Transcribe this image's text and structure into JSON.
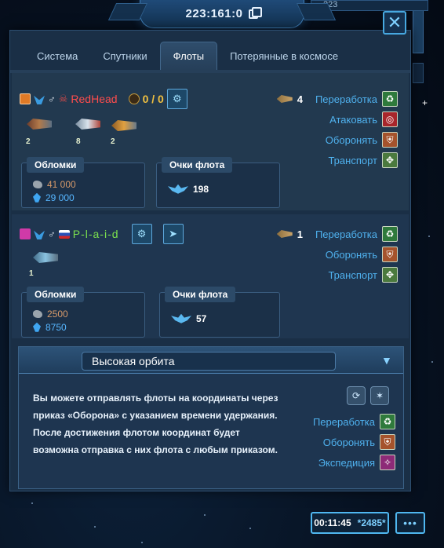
{
  "header": {
    "coordinates": "223:161:0",
    "top_number": "223"
  },
  "tabs": [
    {
      "label": "Система",
      "active": false
    },
    {
      "label": "Спутники",
      "active": false
    },
    {
      "label": "Флоты",
      "active": true
    },
    {
      "label": "Потерянные в космосе",
      "active": false
    }
  ],
  "fleets": [
    {
      "player": "RedHead",
      "slots": "0 / 0",
      "ships": [
        {
          "icon": "ship-heavy-icon",
          "count": "2"
        },
        {
          "icon": "ship-fighter-icon",
          "count": "8"
        },
        {
          "icon": "ship-cruiser-icon",
          "count": "2"
        }
      ],
      "recyclers": "4",
      "debris_label": "Обломки",
      "metal": "41 000",
      "crystal": "29 000",
      "points_label": "Очки флота",
      "points": "198",
      "actions": [
        "Переработка",
        "Атаковать",
        "Оборонять",
        "Транспорт"
      ]
    },
    {
      "player": "P-l-a-i-d",
      "ships": [
        {
          "icon": "ship-drone-icon",
          "count": "1"
        }
      ],
      "recyclers": "1",
      "debris_label": "Обломки",
      "metal": "2500",
      "crystal": "8750",
      "points_label": "Очки флота",
      "points": "57",
      "actions": [
        "Переработка",
        "Оборонять",
        "Транспорт"
      ]
    }
  ],
  "orbit": {
    "title": "Высокая орбита",
    "text": "Вы можете отправлять флоты на координаты через приказ «Оборона» с указанием времени удержания. После достижения флотом координат будет возможна отправка с них флота с любым приказом.",
    "actions": [
      "Переработка",
      "Оборонять",
      "Экспедиция"
    ]
  },
  "footer": {
    "time": "00:11:45",
    "credits": "*2485*",
    "chat": "•••"
  },
  "colors": {
    "accent": "#4fb1ee",
    "enemy_name": "#ff4d4d",
    "ally_name": "#7be04e",
    "slots": "#f0c040"
  }
}
